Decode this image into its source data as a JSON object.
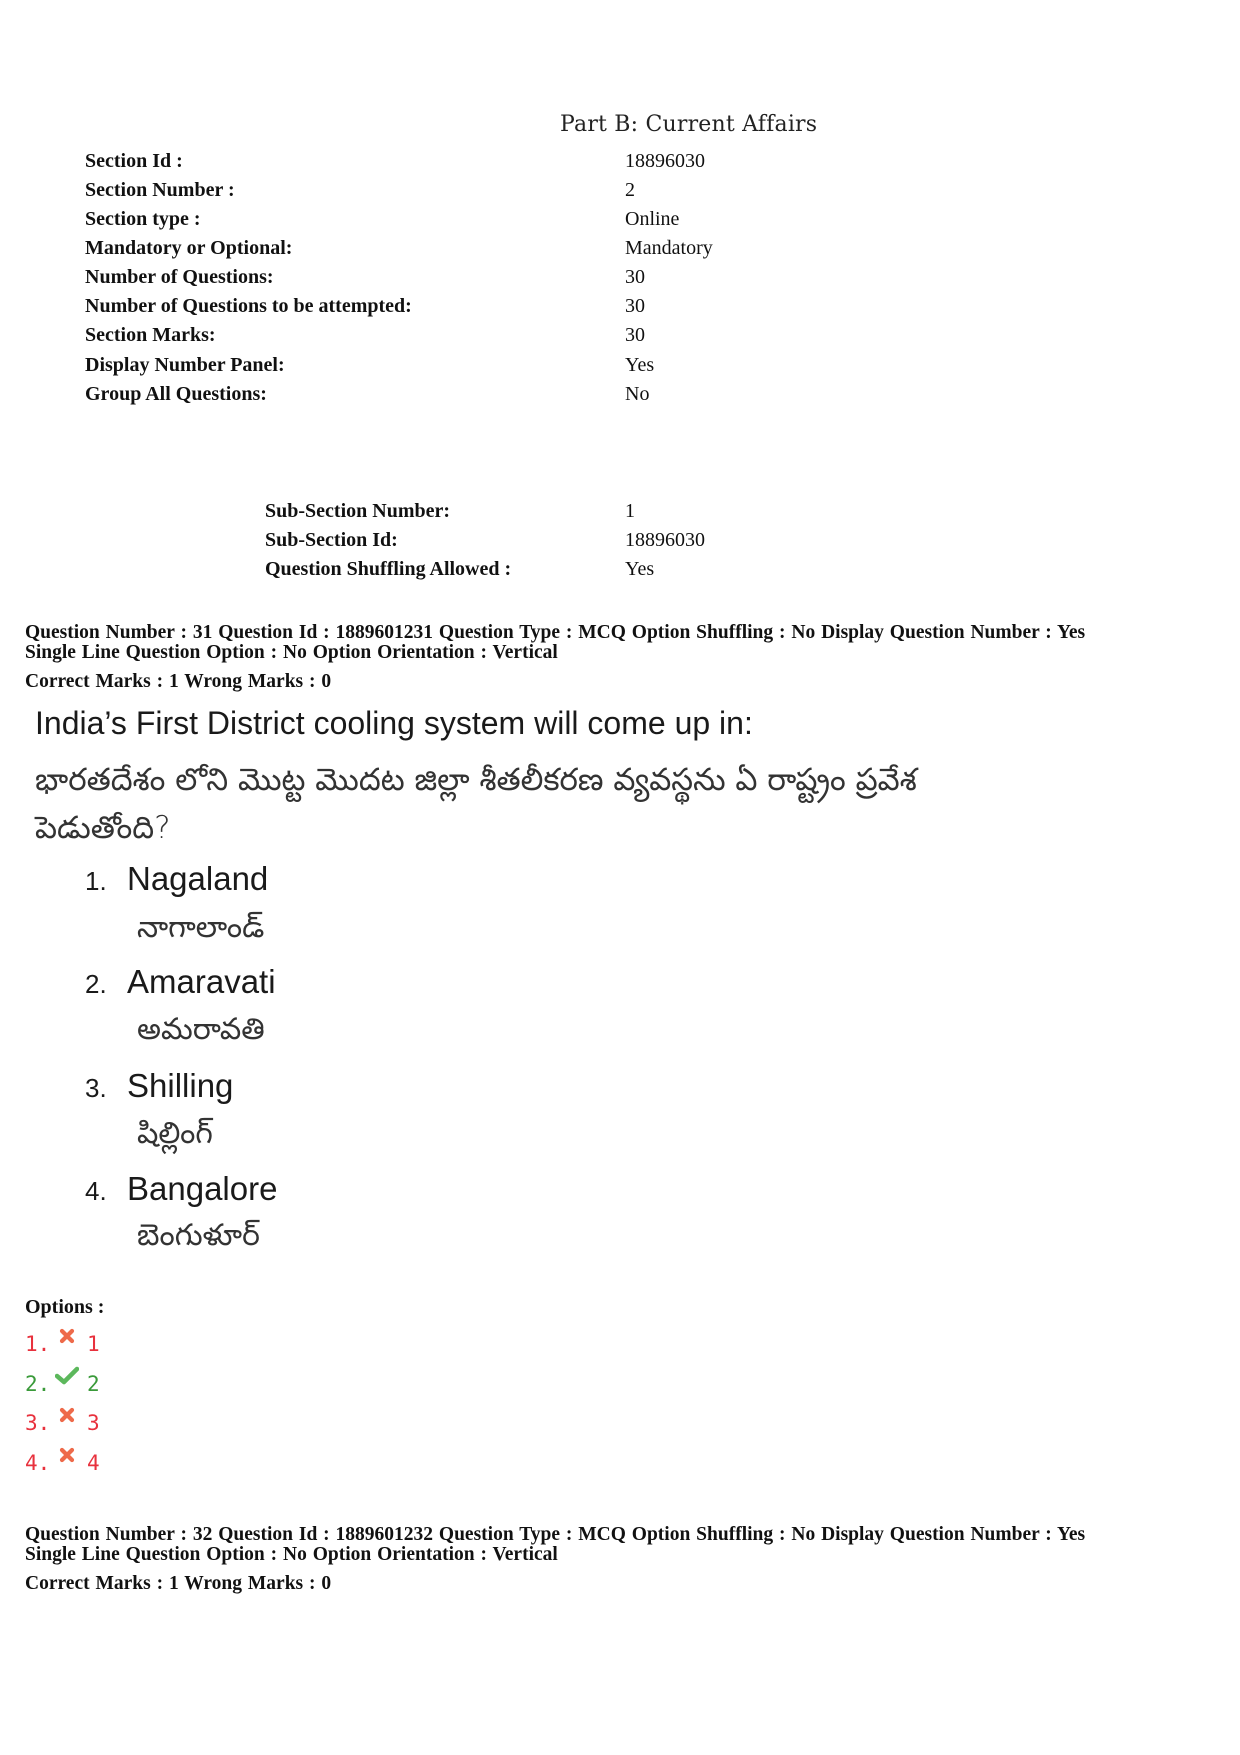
{
  "part_title": "Part B: Current Affairs",
  "section": {
    "fields": [
      {
        "label": "Section Id :",
        "value": "18896030"
      },
      {
        "label": "Section Number :",
        "value": "2"
      },
      {
        "label": "Section type :",
        "value": "Online"
      },
      {
        "label": "Mandatory or Optional:",
        "value": "Mandatory"
      },
      {
        "label": "Number of Questions:",
        "value": "30"
      },
      {
        "label": "Number of Questions to be attempted:",
        "value": "30"
      },
      {
        "label": "Section Marks:",
        "value": "30"
      },
      {
        "label": "Display Number Panel:",
        "value": "Yes"
      },
      {
        "label": "Group All Questions:",
        "value": "No"
      }
    ]
  },
  "subsection": {
    "fields": [
      {
        "label": "Sub-Section Number:",
        "value": "1"
      },
      {
        "label": "Sub-Section Id:",
        "value": "18896030"
      },
      {
        "label": "Question Shuffling Allowed :",
        "value": "Yes"
      }
    ]
  },
  "questions": [
    {
      "header_line1": "Question Number : 31  Question Id : 1889601231  Question Type : MCQ  Option Shuffling : No  Display Question Number : Yes",
      "header_line2": "Single Line Question Option : No  Option Orientation : Vertical",
      "marks": "Correct Marks : 1  Wrong Marks : 0",
      "text_en": "India’s First District cooling system will come up in:",
      "text_te_line1": "భారతదేశం లోని  మొట్ట మొదట జిల్లా శీతలీకరణ వ్యవస్థను ఏ  రాష్ట్రం  ప్రవేశ",
      "text_te_line2": "పెడుతోంది?",
      "choices": [
        {
          "num": "1.",
          "en": "Nagaland",
          "te": "నాగాలాండ్"
        },
        {
          "num": "2.",
          "en": "Amaravati",
          "te": "అమరావతి"
        },
        {
          "num": "3.",
          "en": "Shilling",
          "te": "షిల్లింగ్"
        },
        {
          "num": "4.",
          "en": "Bangalore",
          "te": "బెంగుళూర్"
        }
      ],
      "options_label": "Options :",
      "answers": [
        {
          "num": "1.",
          "value": "1",
          "status": "wrong",
          "icon": "cross-icon"
        },
        {
          "num": "2.",
          "value": "2",
          "status": "correct",
          "icon": "check-icon"
        },
        {
          "num": "3.",
          "value": "3",
          "status": "wrong",
          "icon": "cross-icon"
        },
        {
          "num": "4.",
          "value": "4",
          "status": "wrong",
          "icon": "cross-icon"
        }
      ]
    },
    {
      "header_line1": "Question Number : 32  Question Id : 1889601232  Question Type : MCQ  Option Shuffling : No  Display Question Number : Yes",
      "header_line2": "Single Line Question Option : No  Option Orientation : Vertical",
      "marks": "Correct Marks : 1  Wrong Marks : 0"
    }
  ],
  "colors": {
    "wrong": "#e8313d",
    "correct": "#3a9a3a",
    "cross_icon": "#ee6a4a",
    "check_icon": "#5cb85c"
  }
}
